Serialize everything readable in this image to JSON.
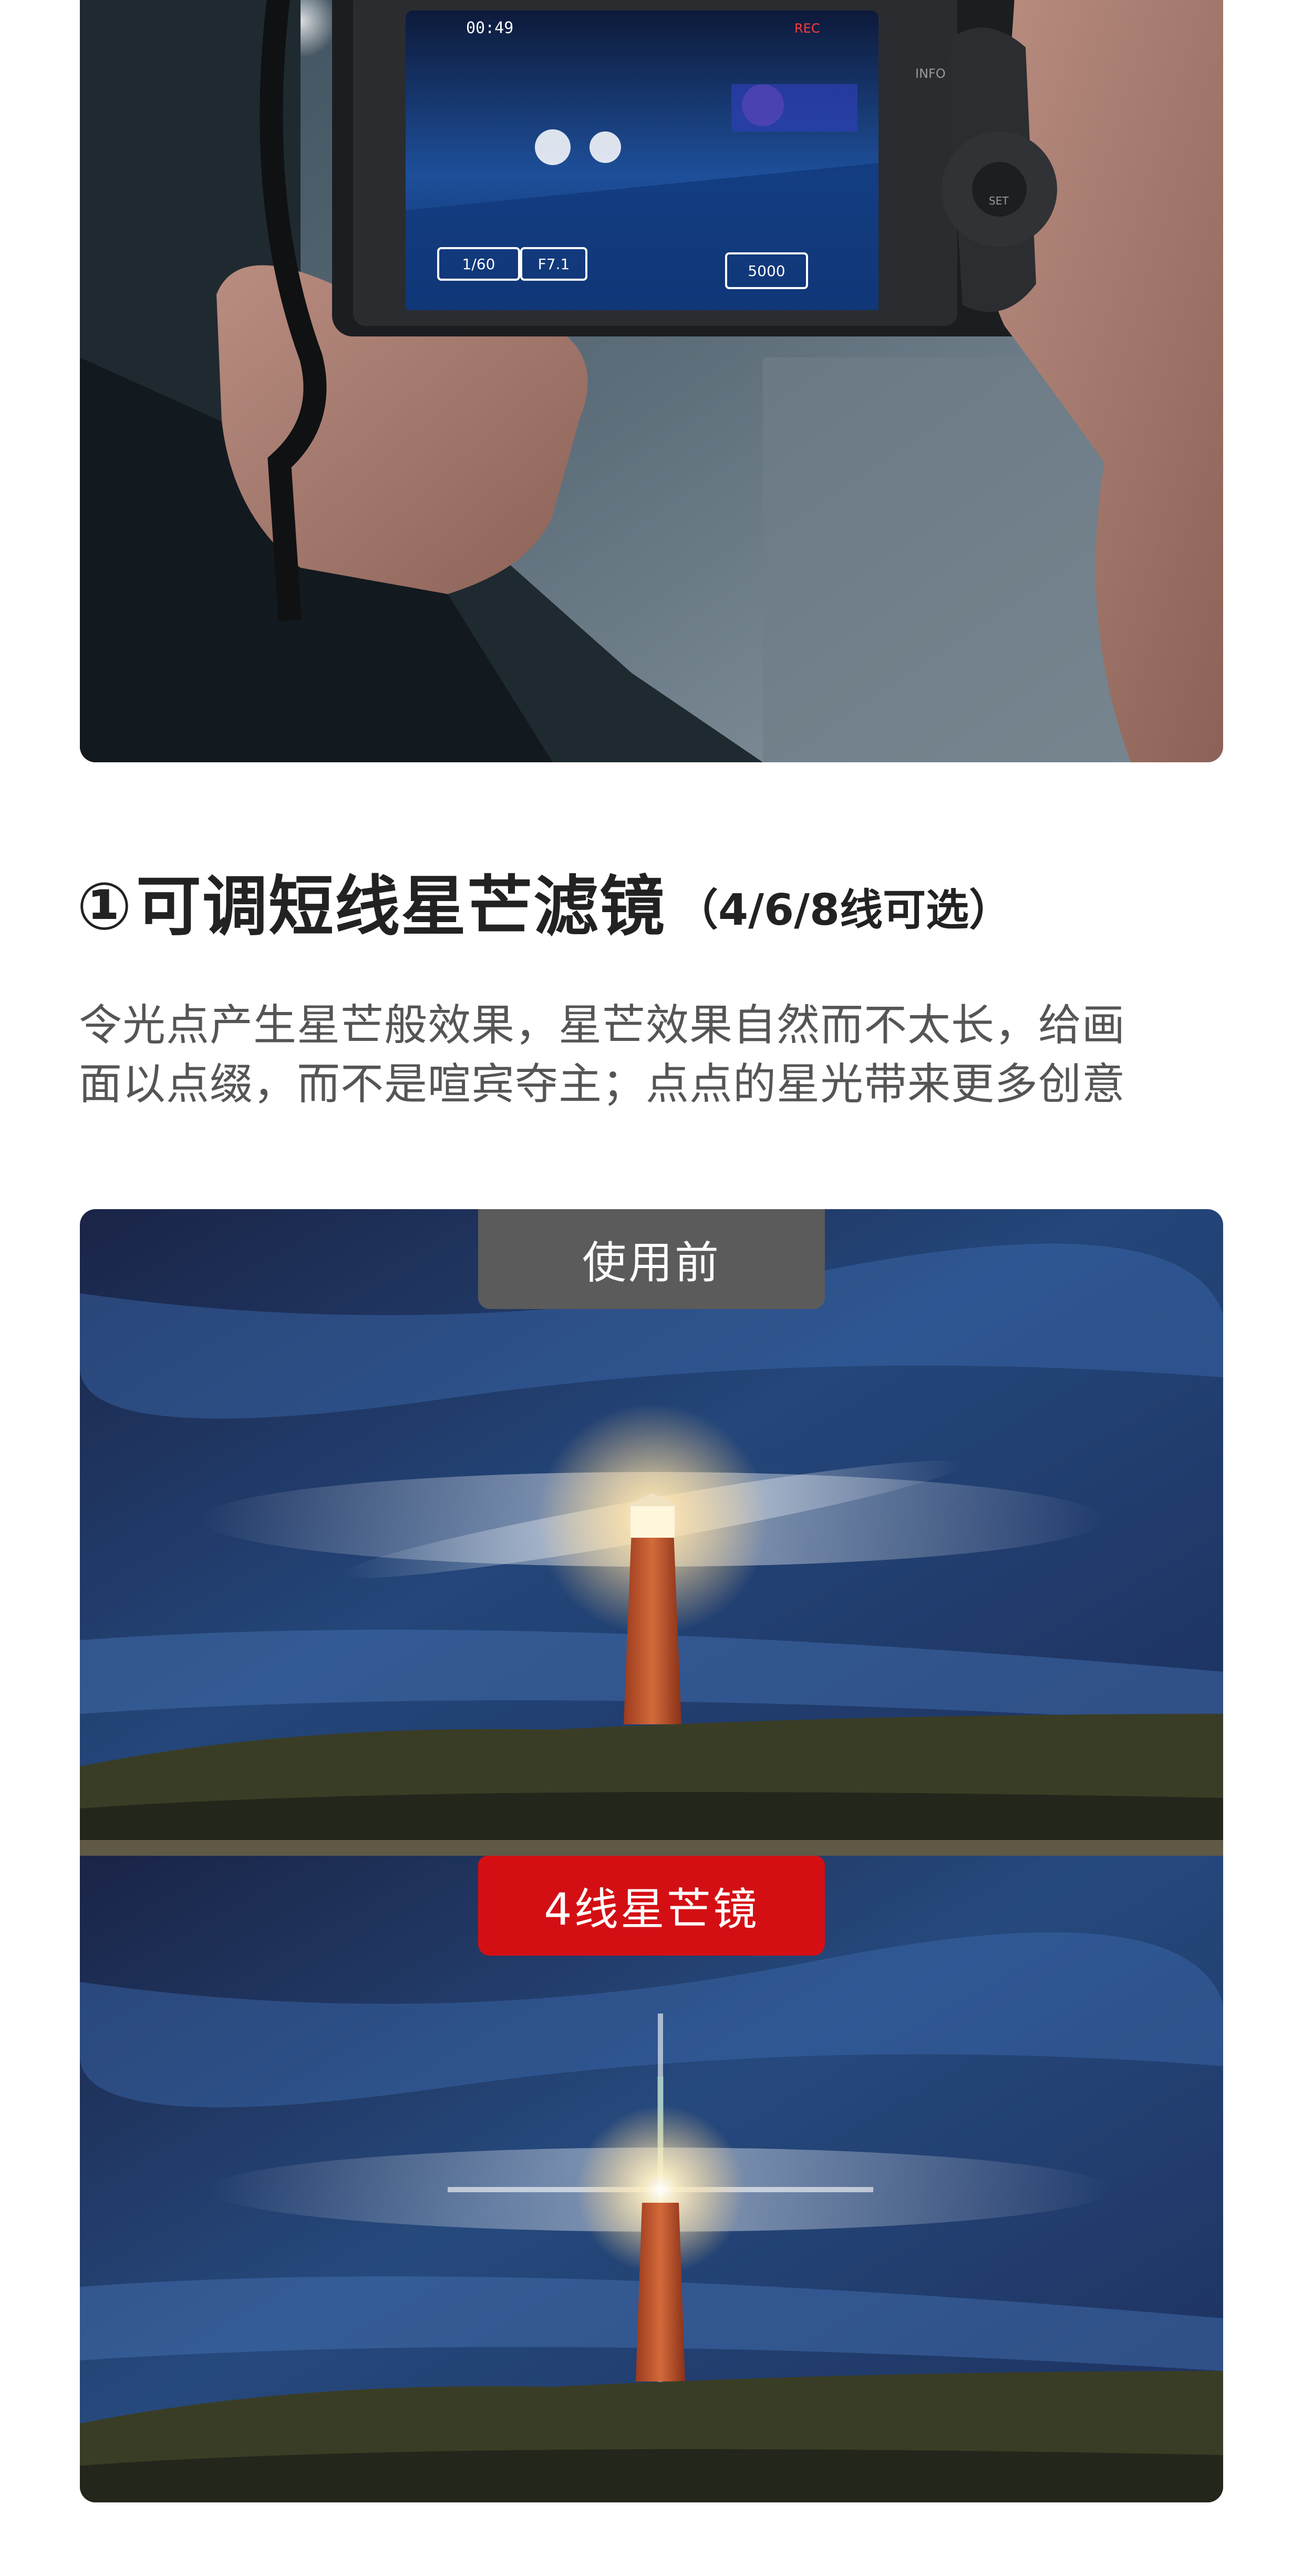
{
  "camera_screen": {
    "timer": "00:49",
    "rec": "REC",
    "shutter": "1/60",
    "aperture": "F7.1",
    "iso": "5000",
    "info_button": "INFO",
    "set_button": "SET"
  },
  "heading": {
    "number": "①",
    "title": "可调短线星芒滤镜",
    "subtitle": "（4/6/8线可选）"
  },
  "description": {
    "lines": [
      "令光点产生星芒般效果，星芒效果自然而不太长，给画",
      "面以点缀，而不是喧宾夺主；点点的星光带来更多创意"
    ]
  },
  "compare": {
    "before_label": "使用前",
    "after_label": "4线星芒镜"
  },
  "colors": {
    "before_tag": "#5b5b5b",
    "after_tag": "#d40f14",
    "heading": "#222222",
    "body_text": "#555555"
  }
}
